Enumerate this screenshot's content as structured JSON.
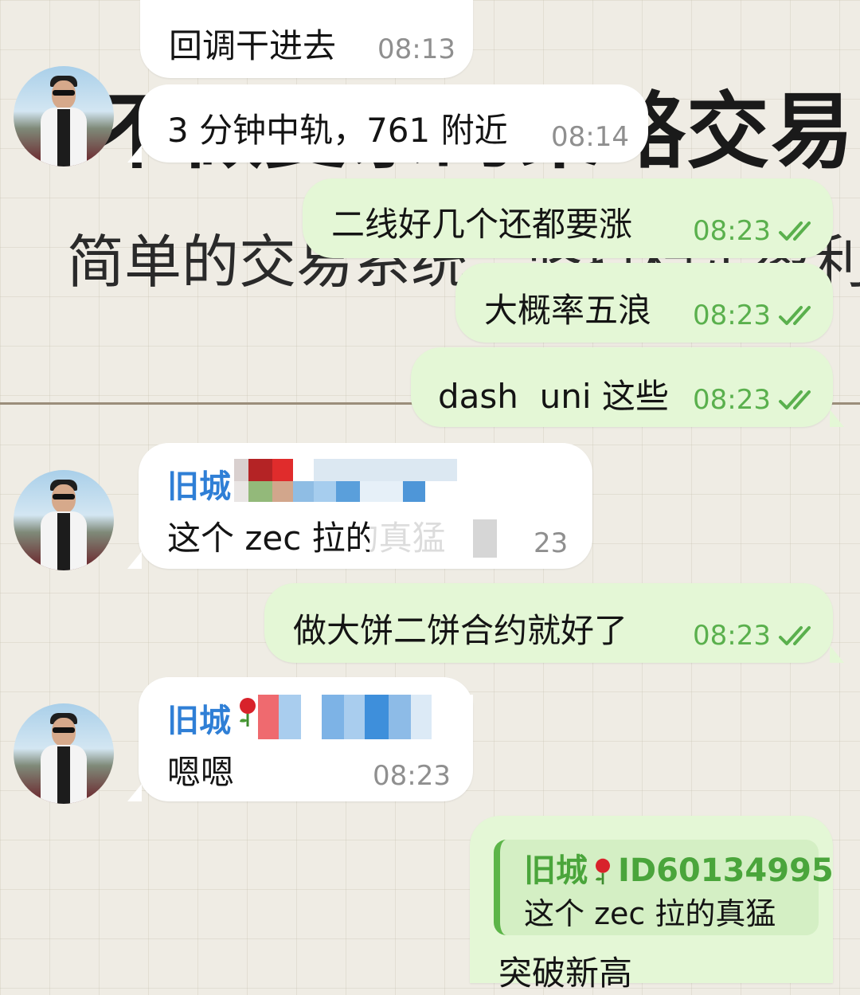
{
  "background": {
    "title_text": "不做复杂的策略交易",
    "subtitle_text": "简单的交易系统，坚持稳定盈利"
  },
  "messages": [
    {
      "id": "m1",
      "direction": "incoming",
      "text": "回调干进去",
      "time": "08:13"
    },
    {
      "id": "m2",
      "direction": "incoming",
      "text": "3 分钟中轨，761 附近",
      "time": "08:14"
    },
    {
      "id": "m3",
      "direction": "outgoing",
      "text": "二线好几个还都要涨",
      "time": "08:23",
      "status": "read"
    },
    {
      "id": "m4",
      "direction": "outgoing",
      "text": "大概率五浪",
      "time": "08:23",
      "status": "read"
    },
    {
      "id": "m5",
      "direction": "outgoing",
      "text": "dash  uni 这些",
      "time": "08:23",
      "status": "read"
    },
    {
      "id": "m6",
      "direction": "incoming",
      "sender": "旧城",
      "text": "这个 zec 拉的真猛",
      "time": "23"
    },
    {
      "id": "m7",
      "direction": "outgoing",
      "text": "做大饼二饼合约就好了",
      "time": "08:23",
      "status": "read"
    },
    {
      "id": "m8",
      "direction": "incoming",
      "sender": "旧城",
      "text": "嗯嗯",
      "time": "08:23"
    },
    {
      "id": "m9",
      "direction": "outgoing",
      "reply_to": {
        "sender": "旧城",
        "sender_id": "ID60134995",
        "text": "这个 zec 拉的真猛"
      },
      "text": "突破新高"
    }
  ],
  "colors": {
    "incoming_bubble": "#ffffff",
    "outgoing_bubble": "#e4f7d6",
    "sender_name": "#2f7fd6",
    "outgoing_time": "#5ab04d",
    "read_check": "#5ab04d"
  },
  "icons": [
    "avatar",
    "double-check-icon",
    "rose-icon"
  ]
}
